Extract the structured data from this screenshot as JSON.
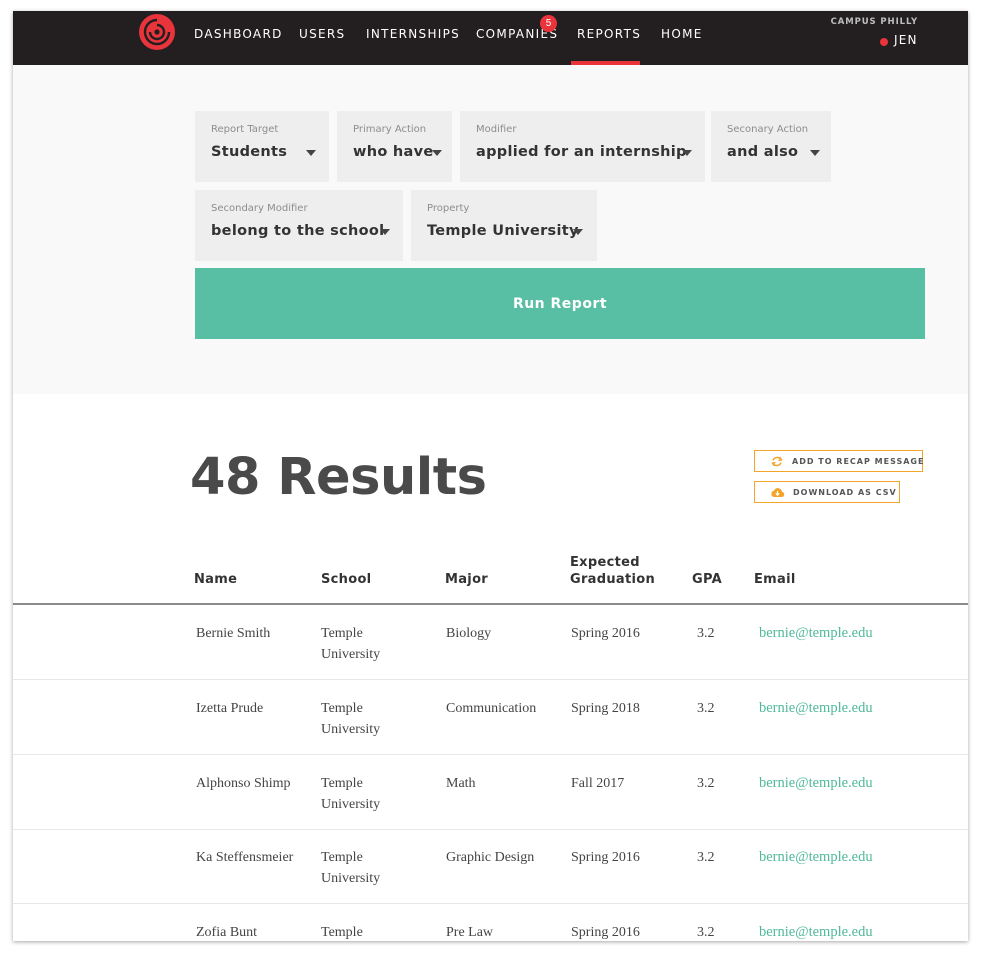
{
  "nav": {
    "items": [
      "DASHBOARD",
      "USERS",
      "INTERNSHIPS",
      "COMPANIES",
      "REPORTS",
      "HOME"
    ],
    "active": "REPORTS",
    "companies_badge": "5",
    "org_name": "CAMPUS PHILLY",
    "user_name": "JEN"
  },
  "colors": {
    "accent_red": "#e8343a",
    "run_button": "#58bfa5",
    "action_border": "#f2a52a",
    "email_link": "#4fb99a",
    "nav_bg": "#231f20"
  },
  "builder": {
    "report_target": {
      "label": "Report Target",
      "value": "Students"
    },
    "primary_action": {
      "label": "Primary Action",
      "value": "who have"
    },
    "modifier": {
      "label": "Modifier",
      "value": "applied for an internship"
    },
    "secondary_action": {
      "label": "Seconary Action",
      "value": "and also"
    },
    "secondary_modifier": {
      "label": "Secondary Modifier",
      "value": "belong to the school"
    },
    "property": {
      "label": "Property",
      "value": "Temple University"
    },
    "run_button": "Run Report"
  },
  "results": {
    "title": "48 Results",
    "add_recap": "ADD TO RECAP MESSAGE",
    "download_csv": "DOWNLOAD AS CSV"
  },
  "table": {
    "headers": {
      "name": "Name",
      "school": "School",
      "major": "Major",
      "graduation_1": "Expected",
      "graduation_2": "Graduation",
      "gpa": "GPA",
      "email": "Email"
    },
    "rows": [
      {
        "name": "Bernie Smith",
        "school_1": "Temple",
        "school_2": "University",
        "major": "Biology",
        "graduation": "Spring 2016",
        "gpa": "3.2",
        "email": "bernie@temple.edu"
      },
      {
        "name": "Izetta Prude",
        "school_1": "Temple",
        "school_2": "University",
        "major": "Communication",
        "graduation": "Spring 2018",
        "gpa": "3.2",
        "email": "bernie@temple.edu"
      },
      {
        "name": "Alphonso Shimp",
        "school_1": "Temple",
        "school_2": "University",
        "major": "Math",
        "graduation": "Fall 2017",
        "gpa": "3.2",
        "email": "bernie@temple.edu"
      },
      {
        "name": "Ka Steffensmeier",
        "school_1": "Temple",
        "school_2": "University",
        "major": "Graphic Design",
        "graduation": "Spring 2016",
        "gpa": "3.2",
        "email": "bernie@temple.edu"
      },
      {
        "name": "Zofia Bunt",
        "school_1": "Temple",
        "school_2": "",
        "major": "Pre Law",
        "graduation": "Spring 2016",
        "gpa": "3.2",
        "email": "bernie@temple.edu"
      }
    ]
  }
}
